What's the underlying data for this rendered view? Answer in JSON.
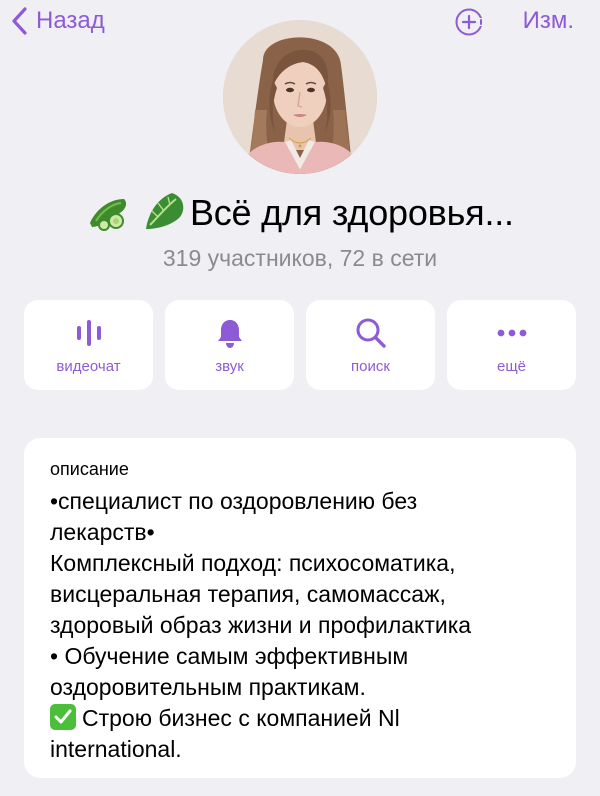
{
  "nav": {
    "back_label": "Назад",
    "edit_label": "Изм.",
    "add_icon": "add-member-icon"
  },
  "profile": {
    "title": "Всё для здоровья...",
    "title_emojis": [
      "cucumber",
      "leafy-green"
    ],
    "subtitle": "319 участников, 72 в сети"
  },
  "actions": [
    {
      "label": "видеочат",
      "icon": "voice-chat-icon"
    },
    {
      "label": "звук",
      "icon": "bell-icon"
    },
    {
      "label": "поиск",
      "icon": "search-icon"
    },
    {
      "label": "ещё",
      "icon": "more-icon"
    }
  ],
  "description": {
    "label": "описание",
    "lines": [
      "•специалист по оздоровлению без",
      "лекарств•",
      "Комплексный подход: психосоматика,",
      "висцеральная терапия, самомассаж,",
      "здоровый образ жизни и профилактика",
      "• Обучение самым эффективным",
      "оздоровительным практикам.",
      "Строю бизнес с компанией Nl",
      "international."
    ]
  },
  "colors": {
    "accent": "#8e5bd6",
    "background": "#efeff4",
    "secondary_text": "#8a8a8f",
    "check_green": "#4bbf3a"
  }
}
